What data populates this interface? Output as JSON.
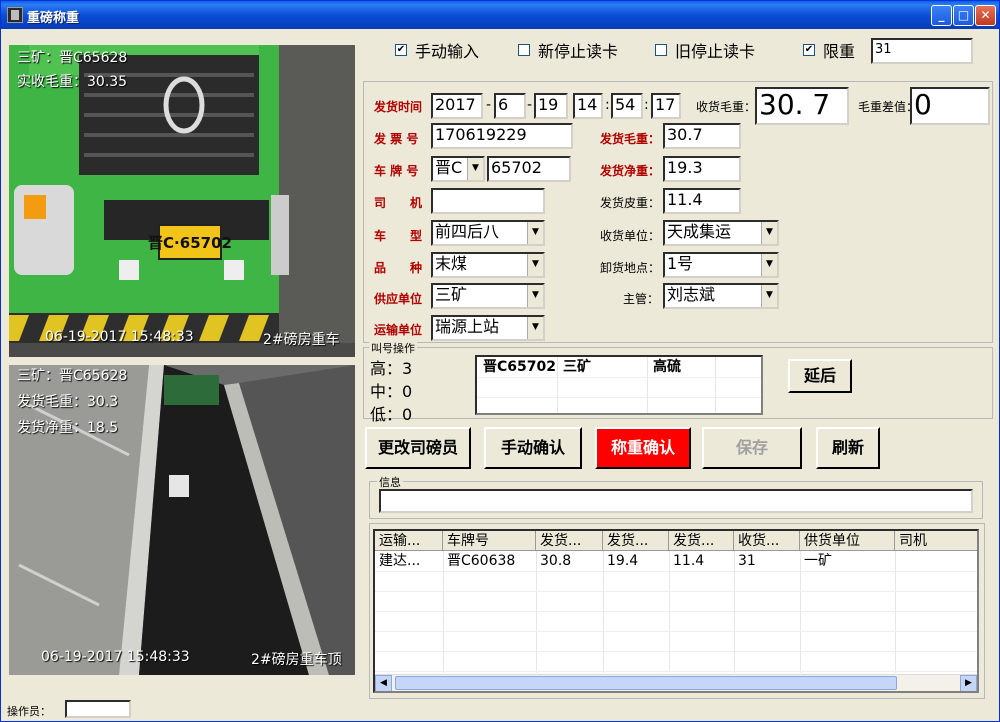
{
  "window": {
    "title": "重磅称重"
  },
  "camera_top": {
    "line1": "三矿：晋C65628",
    "line2": "实收毛重：30.35",
    "plate": "晋C·65702",
    "timestamp": "06-19-2017 15:48:33",
    "location": "2#磅房重车"
  },
  "camera_bottom": {
    "line1": "三矿：晋C65628",
    "line2": "发货毛重：30.3",
    "line3": "发货净重：18.5",
    "timestamp": "06-19-2017 15:48:33",
    "location": "2#磅房重车顶"
  },
  "options": {
    "manual_input": {
      "label": "手动输入",
      "checked": true
    },
    "new_stop_card": {
      "label": "新停止读卡",
      "checked": false
    },
    "old_stop_card": {
      "label": "旧停止读卡",
      "checked": false
    },
    "limit_weight": {
      "label": "限重",
      "checked": true
    },
    "limit_value": "31"
  },
  "form": {
    "ship_time_label": "发货时间",
    "year": "2017",
    "month": "6",
    "day": "19",
    "hour": "14",
    "minute": "54",
    "second": "17",
    "recv_gross_label": "收货毛重：",
    "recv_gross_value": "30. 7",
    "gross_diff_label": "毛重差值：",
    "gross_diff_value": "0",
    "invoice_label": "发 票 号",
    "invoice_value": "170619229",
    "ship_gross_label": "发货毛重：",
    "ship_gross_value": "30.7",
    "plate_label": "车 牌 号",
    "plate_prefix": "晋C",
    "plate_number": "65702",
    "ship_net_label": "发货净重：",
    "ship_net_value": "19.3",
    "driver_label": "司　　机",
    "driver_value": "",
    "ship_tare_label": "发货皮重：",
    "ship_tare_value": "11.4",
    "vehicle_type_label": "车　　型",
    "vehicle_type_value": "前四后八",
    "recv_unit_label": "收货单位：",
    "recv_unit_value": "天成集运",
    "variety_label": "品　　种",
    "variety_value": "末煤",
    "unload_place_label": "卸货地点：",
    "unload_place_value": "1号",
    "supplier_label": "供应单位",
    "supplier_value": "三矿",
    "supervisor_label": "主管：",
    "supervisor_value": "刘志斌",
    "transport_label": "运输单位",
    "transport_value": "瑞源上站"
  },
  "call_panel": {
    "title": "叫号操作",
    "high": "高：3",
    "mid": "中：0",
    "low": "低：0",
    "queue": [
      {
        "plate": "晋C65702",
        "mine": "三矿",
        "sulfur": "高硫"
      }
    ],
    "delay_label": "延后"
  },
  "buttons": {
    "change_weigher": "更改司磅员",
    "manual_confirm": "手动确认",
    "weigh_confirm": "称重确认",
    "save": "保存",
    "refresh": "刷新"
  },
  "info": {
    "title": "信息",
    "value": ""
  },
  "table": {
    "headers": [
      "运输...",
      "车牌号",
      "发货...",
      "发货...",
      "发货...",
      "收货...",
      "供货单位",
      "司机"
    ],
    "rows": [
      [
        "建达...",
        "晋C60638",
        "30.8",
        "19.4",
        "11.4",
        "31",
        "一矿",
        ""
      ]
    ]
  },
  "status": {
    "operator_label": "操作员：",
    "operator_value": ""
  }
}
